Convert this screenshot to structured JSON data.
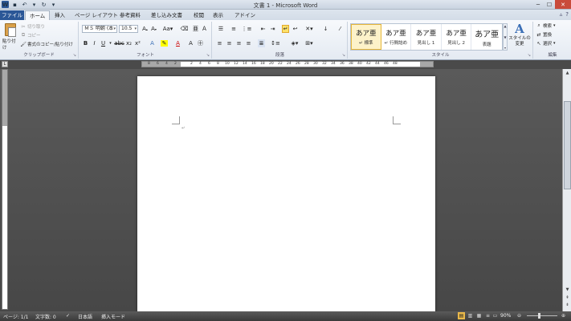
{
  "app": {
    "window_title": "文書 1 - Microsoft Word"
  },
  "tabs": {
    "file": "ファイル",
    "home": "ホーム",
    "insert": "挿入",
    "page_layout": "ページ レイアウト",
    "references": "参考資料",
    "mailings": "差し込み文書",
    "review": "校閲",
    "view": "表示",
    "addins": "アドイン"
  },
  "clipboard": {
    "paste": "貼り付け",
    "cut": "切り取り",
    "copy": "コピー",
    "format_painter": "書式のコピー/貼り付け",
    "label": "クリップボード"
  },
  "font": {
    "font_name": "ＭＳ 明朝 (本",
    "font_size": "10.5",
    "label": "フォント"
  },
  "paragraph": {
    "label": "段落"
  },
  "styles": {
    "items": [
      {
        "sample": "あア亜",
        "name": "↵ 標準"
      },
      {
        "sample": "あア亜",
        "name": "↵ 行間詰め"
      },
      {
        "sample": "あア亜",
        "name": "見出し 1"
      },
      {
        "sample": "あア亜",
        "name": "見出し 2"
      },
      {
        "sample": "あア亜",
        "name": "表題"
      }
    ],
    "change_styles": "スタイルの変更",
    "label": "スタイル"
  },
  "editing": {
    "find": "検索",
    "replace": "置換",
    "select": "選択",
    "label": "編集"
  },
  "ruler": {
    "numbers": [
      "8",
      "6",
      "4",
      "2",
      "2",
      "4",
      "6",
      "8",
      "10",
      "12",
      "14",
      "16",
      "18",
      "20",
      "22",
      "24",
      "26",
      "28",
      "30",
      "32",
      "34",
      "36",
      "38",
      "40",
      "42",
      "44",
      "46",
      "48"
    ]
  },
  "status": {
    "page": "ページ: 1/1",
    "word_count": "文字数: 0",
    "language": "日本語",
    "mode": "挿入モード",
    "zoom": "90%"
  }
}
